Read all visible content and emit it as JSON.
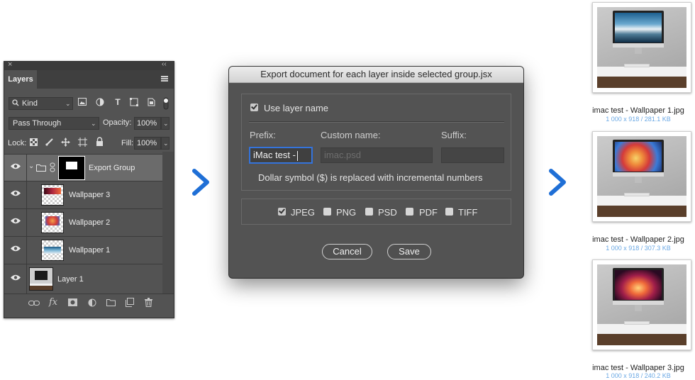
{
  "layers_panel": {
    "close_glyph": "×",
    "collapse_glyph": "‹‹",
    "tab": "Layers",
    "filter_kind": "Kind",
    "blend_mode": "Pass Through",
    "opacity_label": "Opacity:",
    "opacity_value": "100%",
    "lock_label": "Lock:",
    "fill_label": "Fill:",
    "fill_value": "100%",
    "layers": [
      {
        "name": "Export Group",
        "type": "group"
      },
      {
        "name": "Wallpaper 3",
        "type": "layer"
      },
      {
        "name": "Wallpaper 2",
        "type": "layer"
      },
      {
        "name": "Wallpaper 1",
        "type": "layer"
      },
      {
        "name": "Layer 1",
        "type": "layer"
      }
    ],
    "footer_icons": [
      "link-icon",
      "fx-icon",
      "mask-icon",
      "adjustment-icon",
      "folder-icon",
      "new-layer-icon",
      "trash-icon"
    ],
    "fx_label": "fx"
  },
  "dialog": {
    "title": "Export document for each layer inside selected group.jsx",
    "use_layer_name_label": "Use layer name",
    "use_layer_name_checked": true,
    "prefix_label": "Prefix:",
    "prefix_value": "iMac test -",
    "custom_name_label": "Custom name:",
    "custom_name_placeholder": "imac.psd",
    "suffix_label": "Suffix:",
    "suffix_value": "",
    "note": "Dollar symbol ($) is replaced with incremental numbers",
    "formats": [
      {
        "label": "JPEG",
        "checked": true
      },
      {
        "label": "PNG",
        "checked": false
      },
      {
        "label": "PSD",
        "checked": false
      },
      {
        "label": "PDF",
        "checked": false
      },
      {
        "label": "TIFF",
        "checked": false
      }
    ],
    "cancel_label": "Cancel",
    "save_label": "Save"
  },
  "colors": {
    "arrow": "#1f6fd6",
    "meta_text": "#6aa8e4"
  },
  "results": [
    {
      "name": "imac test - Wallpaper 1.jpg",
      "meta": "1 000 x 918 / 281.1 KB"
    },
    {
      "name": "imac test - Wallpaper 2.jpg",
      "meta": "1 000 x 918 / 307.3 KB"
    },
    {
      "name": "imac test - Wallpaper 3.jpg",
      "meta": "1 000 x 918 / 240.2 KB"
    }
  ]
}
